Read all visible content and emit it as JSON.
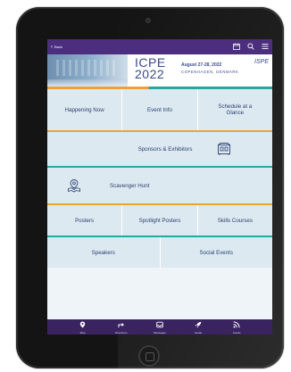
{
  "nav": {
    "back_label": "Back",
    "icons": [
      "calendar-icon",
      "search-icon",
      "menu-icon"
    ]
  },
  "banner": {
    "title_line1": "ICPE",
    "title_line2": "2022",
    "dates": "August 27-28, 2022",
    "location": "COPENHAGEN, DENMARK",
    "logo_text": "ISPE"
  },
  "tiles": {
    "happening_now": "Happening Now",
    "event_info": "Event Info",
    "schedule": "Schedule at a Glance",
    "sponsors": "Sponsors & Exhibitors",
    "scavenger_hunt": "Scavenger Hunt",
    "posters": "Posters",
    "spotlight_posters": "Spotlight Posters",
    "skills_courses": "Skills Courses",
    "speakers": "Speakers",
    "social_events": "Social Events"
  },
  "tab_bar": {
    "items": [
      {
        "label": "Map",
        "icon": "map-pin-icon"
      },
      {
        "label": "Directions",
        "icon": "directions-icon"
      },
      {
        "label": "Messages",
        "icon": "inbox-icon"
      },
      {
        "label": "Guide",
        "icon": "rocket-icon"
      },
      {
        "label": "Feeds",
        "icon": "rss-icon"
      }
    ]
  },
  "colors": {
    "nav_bg": "#4b2f7e",
    "tab_bg": "#3a2460",
    "tile_bg": "#dde9f1",
    "tile_text": "#2a3f6e",
    "accent_orange": "#f0a038",
    "accent_teal": "#2aa6a0"
  }
}
